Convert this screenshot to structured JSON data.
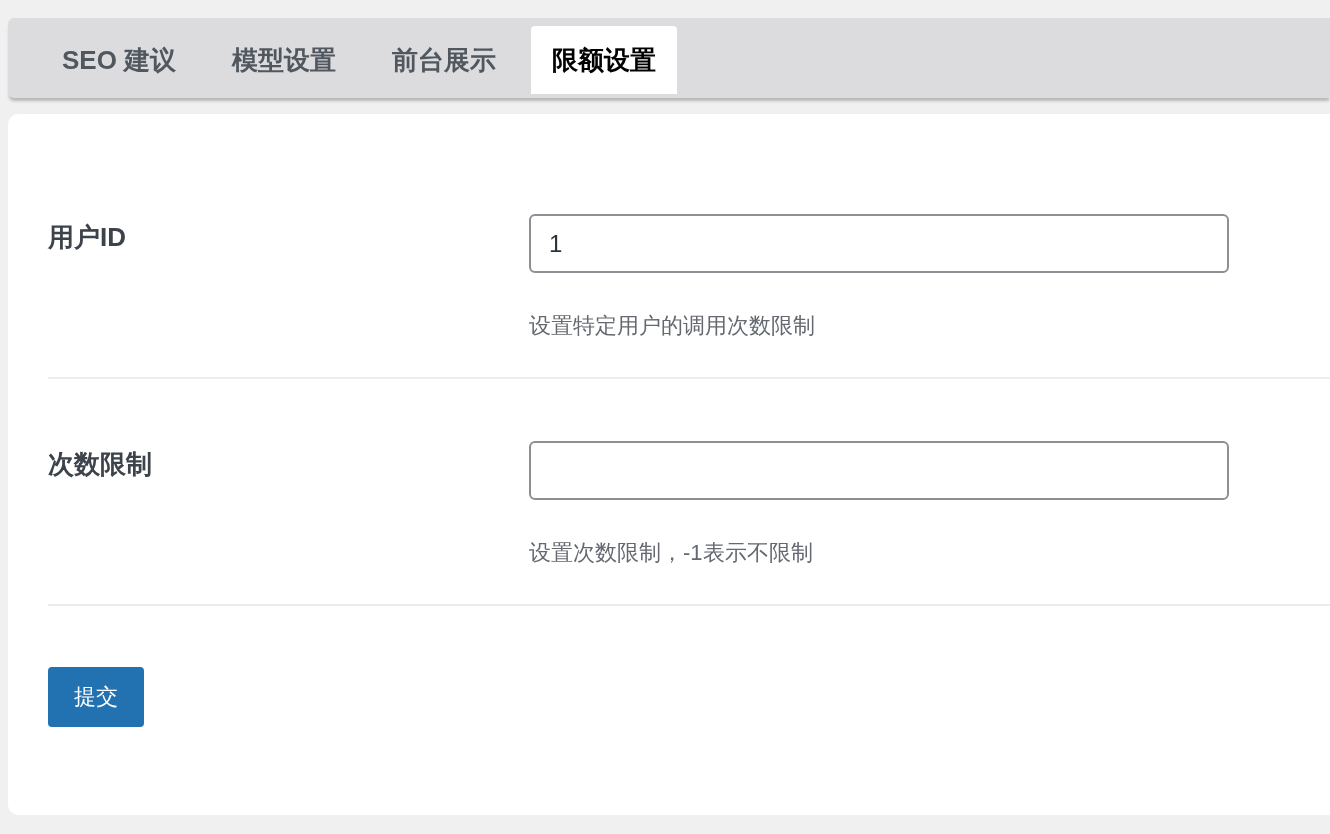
{
  "tabs": [
    {
      "label": "SEO 建议",
      "selected": false
    },
    {
      "label": "模型设置",
      "selected": false
    },
    {
      "label": "前台展示",
      "selected": false
    },
    {
      "label": "限额设置",
      "selected": true
    }
  ],
  "fields": [
    {
      "label": "用户ID",
      "value": "1",
      "hint": "设置特定用户的调用次数限制"
    },
    {
      "label": "次数限制",
      "hint": "设置次数限制，-1表示不限制"
    }
  ],
  "submit_button": "提交"
}
